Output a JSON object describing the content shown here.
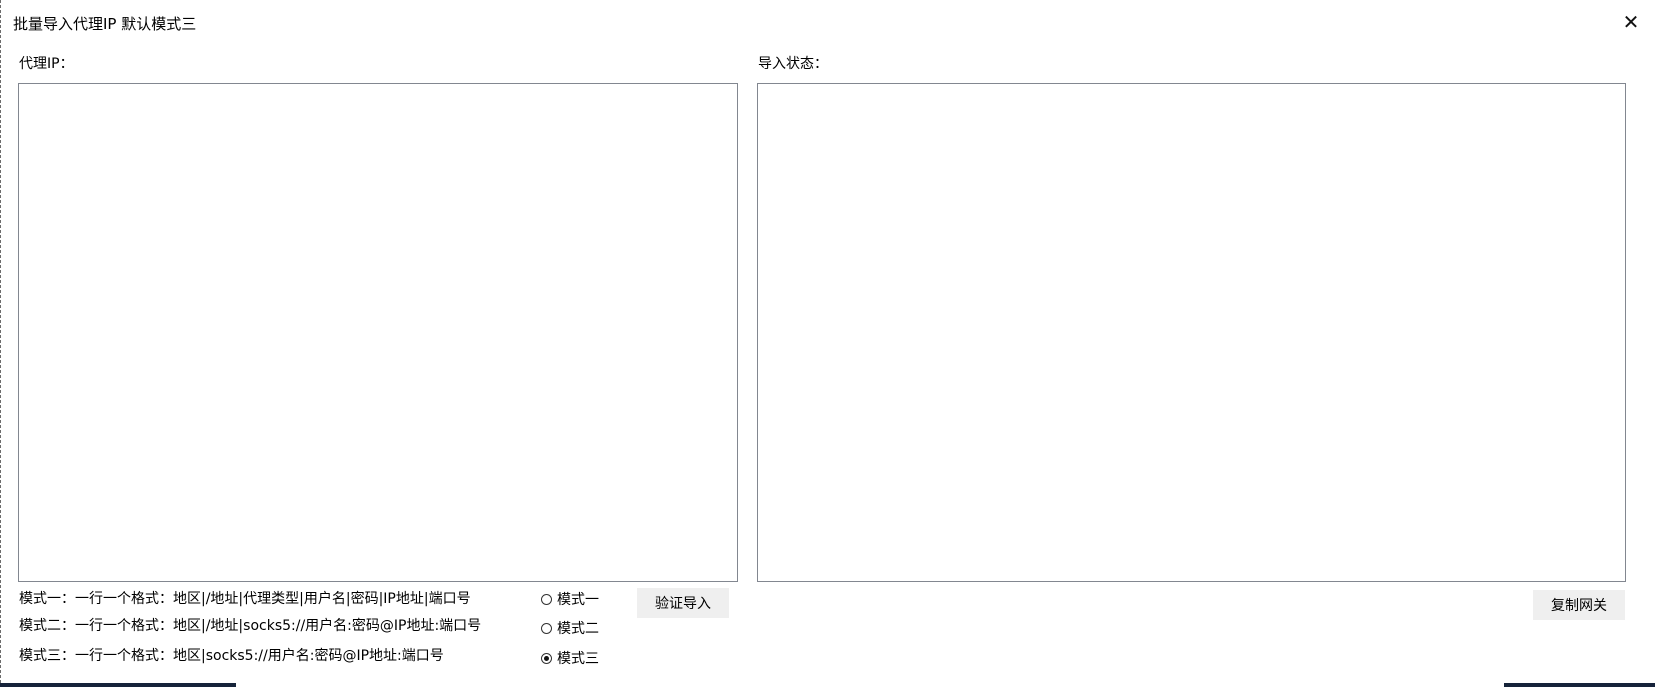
{
  "window": {
    "title": "批量导入代理IP  默认模式三",
    "close_glyph": "✕"
  },
  "left_panel": {
    "label": "代理IP：",
    "value": ""
  },
  "right_panel": {
    "label": "导入状态：",
    "value": ""
  },
  "modes": [
    {
      "description": "模式一：一行一个格式：地区|/地址|代理类型|用户名|密码|IP地址|端口号",
      "option_label": "模式一",
      "selected": false
    },
    {
      "description": "模式二：一行一个格式：地区|/地址|socks5://用户名:密码@IP地址:端口号",
      "option_label": "模式二",
      "selected": false
    },
    {
      "description": "模式三：一行一个格式：地区|socks5://用户名:密码@IP地址:端口号",
      "option_label": "模式三",
      "selected": true
    }
  ],
  "buttons": {
    "validate_import": "验证导入",
    "copy_gateway": "复制网关"
  },
  "colors": {
    "border": "#828790",
    "button_bg": "#efefef",
    "taskbar": "#16233a"
  },
  "icons": {
    "close": "close-icon",
    "radio": "radio-icon"
  }
}
